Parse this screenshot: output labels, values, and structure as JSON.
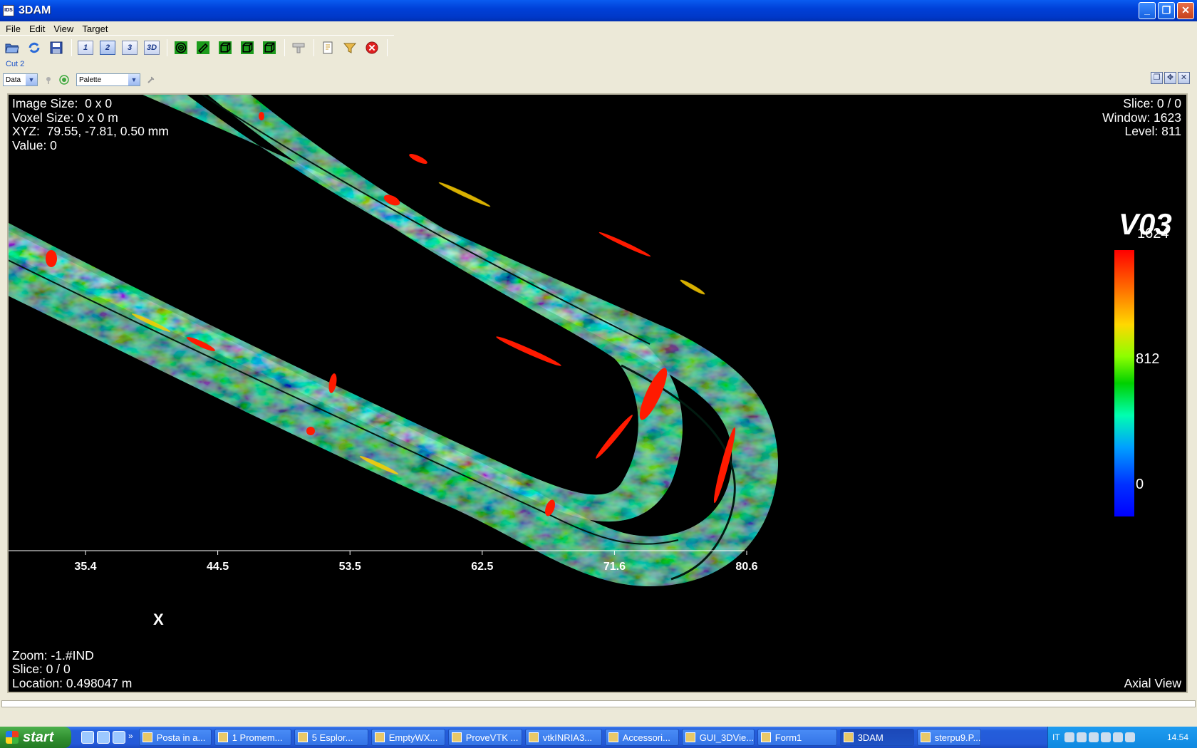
{
  "window": {
    "title": "3DAM",
    "app_icon_text": "IDS",
    "minimize": "_",
    "maximize": "❐",
    "close": "✕"
  },
  "menu": [
    "File",
    "Edit",
    "View",
    "Target"
  ],
  "toolbar": {
    "view_buttons": [
      "1",
      "2",
      "3",
      "3D"
    ]
  },
  "tab": {
    "label": "Cut 2"
  },
  "controls": {
    "data_combo": "Data",
    "palette_combo": "Palette"
  },
  "overlay": {
    "top_left": "Image Size:  0 x 0\nVoxel Size: 0 x 0 m\nXYZ:  79.55, -7.81, 0.50 mm\nValue: 0",
    "top_right": "Slice: 0 / 0\nWindow: 1623\nLevel: 811",
    "bottom_left": "Zoom: -1.#IND\nSlice: 0 / 0\nLocation: 0.498047 m",
    "bottom_right": "Axial View"
  },
  "colorbar": {
    "title": "V03",
    "max": "1624",
    "mid": "812",
    "min": "0",
    "colors": [
      "#ff0000",
      "#ffd800",
      "#00d000",
      "#00a0ff",
      "#0000ff"
    ]
  },
  "axis": {
    "name": "X",
    "ticks": [
      "35.4",
      "44.5",
      "53.5",
      "62.5",
      "71.6",
      "80.6"
    ]
  },
  "taskbar": {
    "start": "start",
    "tasks": [
      {
        "label": "Posta in a...",
        "active": false
      },
      {
        "label": "1 Promem...",
        "active": false
      },
      {
        "label": "5 Esplor...",
        "active": false
      },
      {
        "label": "EmptyWX...",
        "active": false
      },
      {
        "label": "ProveVTK ...",
        "active": false
      },
      {
        "label": "vtkINRIA3...",
        "active": false
      },
      {
        "label": "Accessori...",
        "active": false
      },
      {
        "label": "GUI_3DVie...",
        "active": false
      },
      {
        "label": "Form1",
        "active": false
      },
      {
        "label": "3DAM",
        "active": true
      },
      {
        "label": "sterpu9.P...",
        "active": false
      }
    ],
    "language": "IT",
    "clock": "14.54"
  }
}
